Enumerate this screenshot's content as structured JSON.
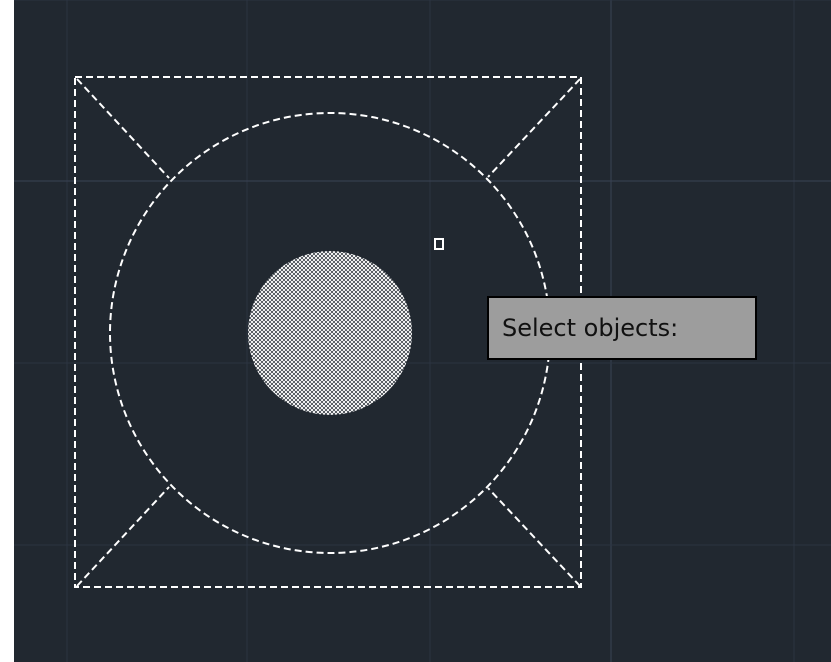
{
  "viewport": {
    "background": "#212830",
    "grid_color": "#2c3441",
    "grid_major_color": "#394354",
    "selection_color": "#ffffff"
  },
  "tooltip": {
    "prompt": "Select objects:"
  },
  "cursor": {
    "icon": "pickbox-icon"
  },
  "drawing": {
    "objects": [
      "selected-square",
      "selected-diagonals",
      "selected-circle",
      "hatched-circle"
    ]
  }
}
